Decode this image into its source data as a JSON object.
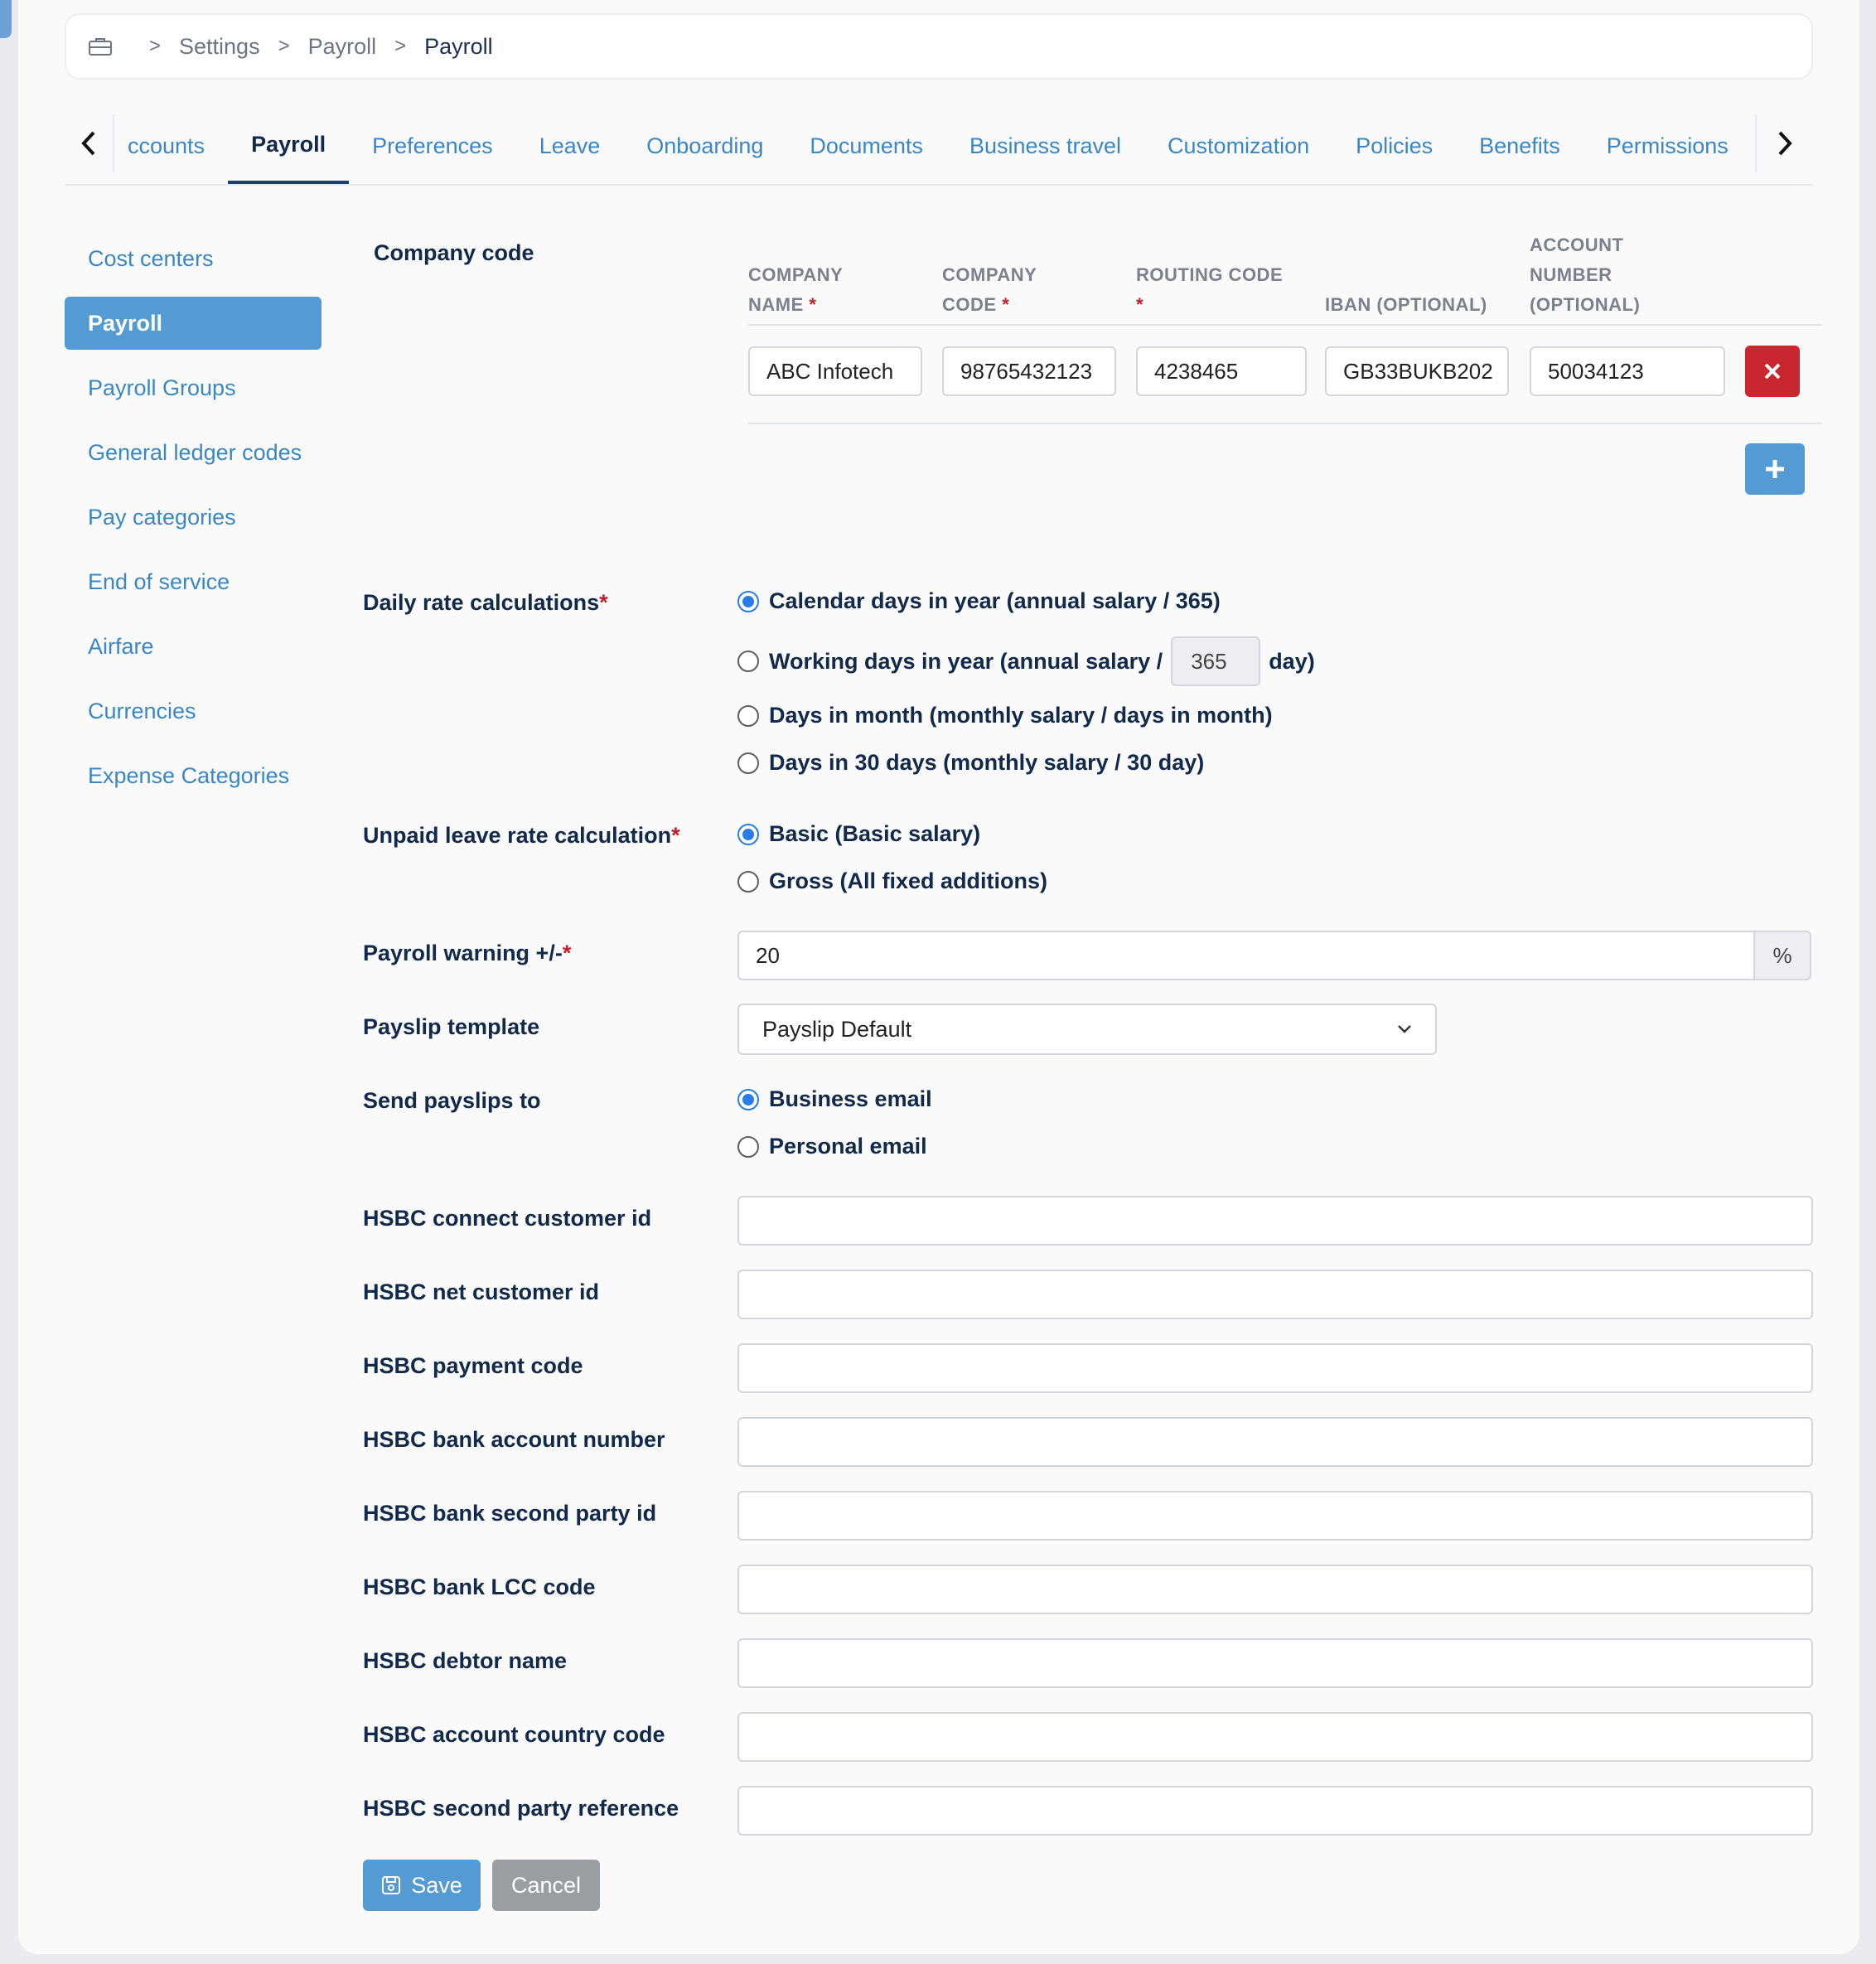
{
  "breadcrumb": {
    "items": [
      "Settings",
      "Payroll",
      "Payroll"
    ]
  },
  "tabs": {
    "items": [
      "ccounts",
      "Payroll",
      "Preferences",
      "Leave",
      "Onboarding",
      "Documents",
      "Business travel",
      "Customization",
      "Policies",
      "Benefits",
      "Permissions"
    ],
    "active": "Payroll"
  },
  "sidebar": {
    "items": [
      "Cost centers",
      "Payroll",
      "Payroll Groups",
      "General ledger codes",
      "Pay categories",
      "End of service",
      "Airfare",
      "Currencies",
      "Expense Categories"
    ],
    "active": "Payroll"
  },
  "company": {
    "label": "Company code",
    "headers": {
      "name_l1": "COMPANY",
      "name_l2": "NAME",
      "code_l1": "COMPANY",
      "code_l2": "CODE",
      "routing_l1": "ROUTING CODE",
      "iban": "IBAN (OPTIONAL)",
      "acct_l1": "ACCOUNT",
      "acct_l2": "NUMBER",
      "acct_l3": "(OPTIONAL)"
    },
    "required_mark": "*",
    "row": {
      "name": "ABC Infotech",
      "code": "98765432123",
      "routing": "4238465",
      "iban": "GB33BUKB202",
      "account": "50034123"
    }
  },
  "daily_rate": {
    "label": "Daily rate calculations",
    "options": [
      "Calendar days in year (annual salary / 365)",
      "Working days in year (annual salary /",
      "Days in month (monthly salary / days in month)",
      "Days in 30 days (monthly salary / 30 day)"
    ],
    "working_days_value": "365",
    "working_days_suffix": "day)",
    "selected": 0
  },
  "unpaid_leave": {
    "label": "Unpaid leave rate calculation",
    "options": [
      "Basic (Basic salary)",
      "Gross (All fixed additions)"
    ],
    "selected": 0
  },
  "payroll_warning": {
    "label": "Payroll warning +/-",
    "value": "20",
    "unit": "%"
  },
  "payslip_template": {
    "label": "Payslip template",
    "value": "Payslip Default"
  },
  "send_payslips": {
    "label": "Send payslips to",
    "options": [
      "Business email",
      "Personal email"
    ],
    "selected": 0
  },
  "hsbc_fields": [
    {
      "label": "HSBC connect customer id",
      "value": ""
    },
    {
      "label": "HSBC net customer id",
      "value": ""
    },
    {
      "label": "HSBC payment code",
      "value": ""
    },
    {
      "label": "HSBC bank account number",
      "value": ""
    },
    {
      "label": "HSBC bank second party id",
      "value": ""
    },
    {
      "label": "HSBC bank LCC code",
      "value": ""
    },
    {
      "label": "HSBC debtor name",
      "value": ""
    },
    {
      "label": "HSBC account country code",
      "value": ""
    },
    {
      "label": "HSBC second party reference",
      "value": ""
    }
  ],
  "actions": {
    "save": "Save",
    "cancel": "Cancel"
  },
  "icons": {
    "breadcrumb_home": "briefcase-icon",
    "chevron_left": "chevron-left-icon",
    "chevron_right": "chevron-right-icon",
    "delete": "close-icon",
    "add": "plus-icon",
    "select": "chevron-down-icon",
    "save": "floppy-disk-icon"
  },
  "colors": {
    "accent": "#559bd3",
    "link": "#3b87c6",
    "danger": "#c9272f",
    "heading": "#12294a",
    "cancel": "#9a9ea3"
  }
}
